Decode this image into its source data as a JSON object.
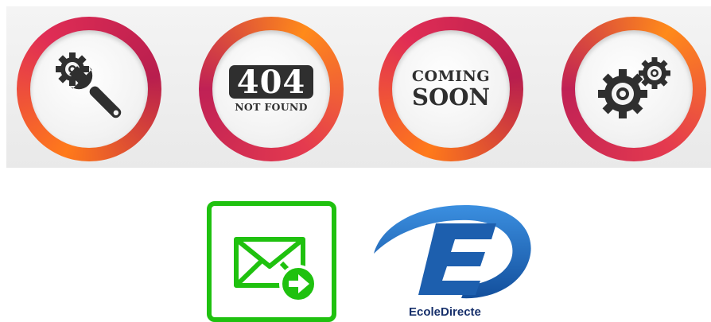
{
  "badges": [
    {
      "icon": "wrench-gear-icon"
    },
    {
      "code": "404",
      "caption": "NOT FOUND"
    },
    {
      "line1": "COMING",
      "line2": "SOON"
    },
    {
      "icon": "gears-icon"
    }
  ],
  "tiles": {
    "mail": {
      "icon": "mail-send-icon",
      "color": "#1fc10f"
    },
    "ecole_directe": {
      "brand": "EcoleDirecte",
      "color": "#1d5fae"
    }
  },
  "colors": {
    "ring_orange": "#ff7a1a",
    "ring_crimson": "#c02155",
    "icon_dark": "#2f2f2f"
  }
}
